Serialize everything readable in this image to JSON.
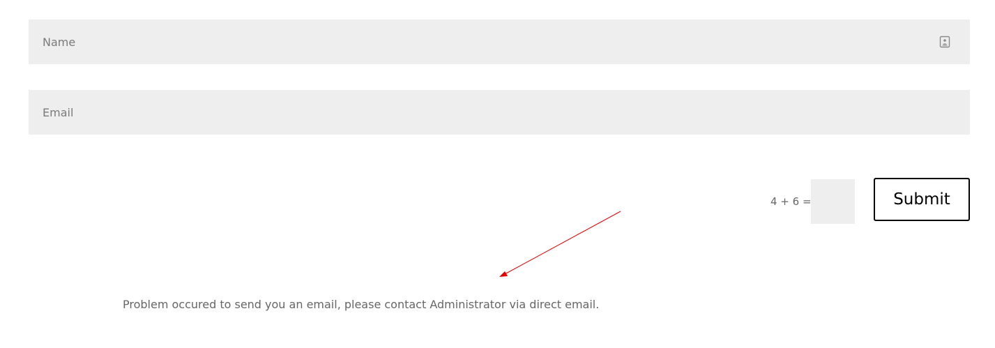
{
  "form": {
    "name": {
      "placeholder": "Name",
      "value": "",
      "icon": "contact-card-icon"
    },
    "email": {
      "placeholder": "Email",
      "value": ""
    },
    "captcha": {
      "question": "4 + 6 =",
      "value": ""
    },
    "submit_label": "Submit"
  },
  "message": {
    "text": "Problem occured to send you an email, please contact Administrator via direct email."
  },
  "annotation": {
    "arrow_color": "#e60000"
  },
  "colors": {
    "field_background": "#eeeeee",
    "placeholder_text": "#7a7a7a",
    "body_text": "#666666",
    "button_border": "#000000"
  }
}
